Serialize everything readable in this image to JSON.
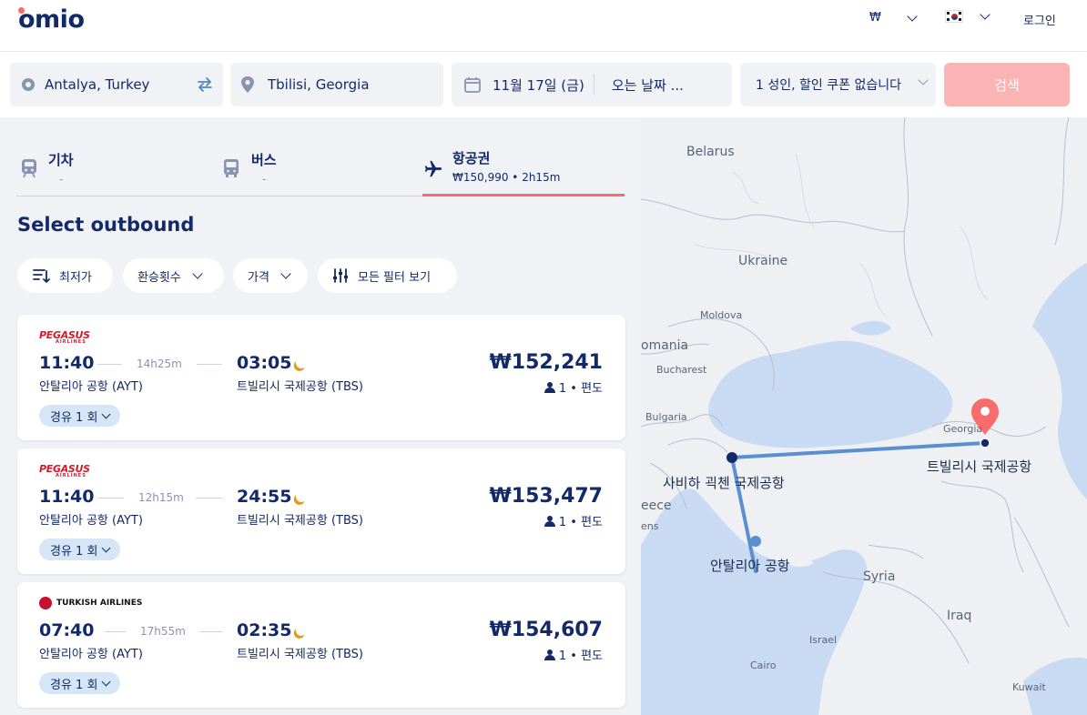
{
  "header": {
    "logo": "omio",
    "currency": "₩",
    "login": "로그인"
  },
  "search": {
    "origin": "Antalya, Turkey",
    "destination": "Tbilisi, Georgia",
    "depart_date": "11월 17일 (금)",
    "return_date": "오는 날짜 ...",
    "passengers": "1 성인, 할인 쿠폰 없습니다",
    "search_label": "검색"
  },
  "tabs": [
    {
      "label": "기차",
      "sub": "-"
    },
    {
      "label": "버스",
      "sub": "-"
    },
    {
      "label": "항공권",
      "sub": "₩150,990 • 2h15m"
    }
  ],
  "title": "Select outbound",
  "filters": {
    "sort": "최저가",
    "transfers": "환승횟수",
    "price": "가격",
    "all": "모든 필터 보기"
  },
  "results": [
    {
      "airline": "PEGASUS",
      "airline_sub": "AIRLINES",
      "dep_time": "11:40",
      "duration": "14h25m",
      "arr_time": "03:05",
      "dep_airport": "안탈리아 공항 (AYT)",
      "arr_airport": "트빌리시 국제공항 (TBS)",
      "price": "₩152,241",
      "pax": "1 • 편도",
      "stops": "경유 1 회"
    },
    {
      "airline": "PEGASUS",
      "airline_sub": "AIRLINES",
      "dep_time": "11:40",
      "duration": "12h15m",
      "arr_time": "24:55",
      "dep_airport": "안탈리아 공항 (AYT)",
      "arr_airport": "트빌리시 국제공항 (TBS)",
      "price": "₩153,477",
      "pax": "1 • 편도",
      "stops": "경유 1 회"
    },
    {
      "airline": "TURKISH AIRLINES",
      "dep_time": "07:40",
      "duration": "17h55m",
      "arr_time": "02:35",
      "dep_airport": "안탈리아 공항 (AYT)",
      "arr_airport": "트빌리시 국제공항 (TBS)",
      "price": "₩154,607",
      "pax": "1 • 편도",
      "stops": "경유 1 회"
    }
  ],
  "map": {
    "labels": {
      "belarus": "Belarus",
      "ukraine": "Ukraine",
      "moldova": "Moldova",
      "romania": "omania",
      "bucharest": "Bucharest",
      "bulgaria": "Bulgaria",
      "greece": "eece",
      "athens": "ens",
      "georgia": "Georgia",
      "syria": "Syria",
      "iraq": "Iraq",
      "israel": "Israel",
      "cairo": "Cairo",
      "kuwait": "Kuwait"
    },
    "airports": {
      "saw": "사비하 괵첸 국제공항",
      "tbs": "트빌리시 국제공항",
      "ayt": "안탈리아 공항"
    },
    "colors": {
      "route": "#5b8fd0",
      "pin": "#fa6b6b",
      "sea": "#c9daf3"
    }
  }
}
